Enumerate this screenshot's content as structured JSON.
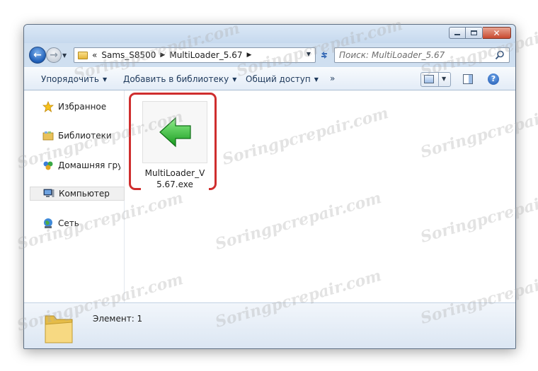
{
  "navigation": {
    "breadcrumbs": [
      "Sams_S8500",
      "MultiLoader_5.67"
    ],
    "breadcrumb_prefix": "«",
    "search_placeholder": "Поиск: MultiLoader_5.67"
  },
  "toolbar": {
    "organize_label": "Упорядочить",
    "add_to_library_label": "Добавить в библиотеку",
    "share_label": "Общий доступ",
    "more_label": "»"
  },
  "sidebar": {
    "items": [
      {
        "label": "Избранное",
        "icon": "star-icon"
      },
      {
        "label": "Библиотеки",
        "icon": "libraries-icon"
      },
      {
        "label": "Домашняя групп",
        "icon": "homegroup-icon"
      },
      {
        "label": "Компьютер",
        "icon": "computer-icon"
      },
      {
        "label": "Сеть",
        "icon": "network-icon"
      }
    ]
  },
  "files": [
    {
      "name": "MultiLoader_V5.67.exe",
      "icon": "green-arrow-left-icon"
    }
  ],
  "status": {
    "item_count_text": "Элемент: 1"
  },
  "watermark": {
    "text": "Soringpcrepair.com"
  },
  "colors": {
    "highlight_border": "#cf2e2e",
    "arrow_green": "#2bb52b",
    "chrome_blue": "#cfdff0"
  }
}
